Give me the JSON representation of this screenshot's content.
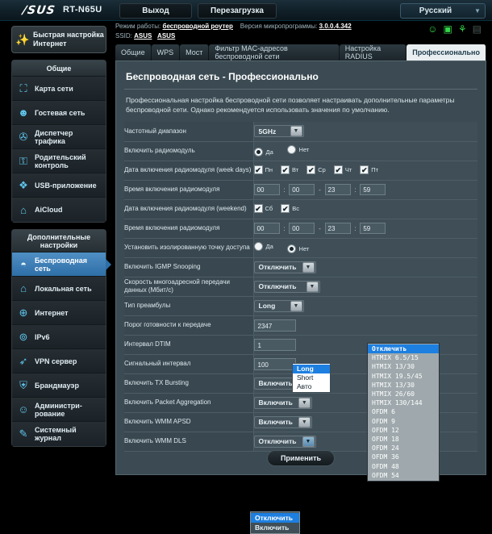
{
  "header": {
    "brand": "/SUS",
    "model": "RT-N65U",
    "logout_label": "Выход",
    "reboot_label": "Перезагрузка",
    "language": "Русский"
  },
  "info": {
    "mode_label": "Режим работы:",
    "mode_value": "беспроводной роутер",
    "firmware_label": "Версия микропрограммы:",
    "firmware_value": "3.0.0.4.342",
    "ssid_label": "SSID:",
    "ssid_1": "ASUS",
    "ssid_2": "ASUS",
    "status_icons": [
      "user-icon",
      "monitor-icon",
      "usb-icon",
      "printer-icon"
    ]
  },
  "quick_setup": {
    "line1": "Быстрая настройка",
    "line2": "Интернет"
  },
  "sidebar": {
    "general_header": "Общие",
    "general_items": [
      {
        "label": "Карта сети",
        "icon": "network-map-icon"
      },
      {
        "label": "Гостевая сеть",
        "icon": "guest-network-icon"
      },
      {
        "label": "Диспетчер трафика",
        "icon": "traffic-manager-icon"
      },
      {
        "label": "Родительский контроль",
        "icon": "parental-control-icon"
      },
      {
        "label": "USB-приложение",
        "icon": "usb-application-icon"
      },
      {
        "label": "AiCloud",
        "icon": "aicloud-icon"
      }
    ],
    "advanced_header": "Дополнительные настройки",
    "advanced_items": [
      {
        "label": "Беспроводная сеть",
        "icon": "wireless-icon",
        "active": true
      },
      {
        "label": "Локальная сеть",
        "icon": "lan-icon",
        "active": false
      },
      {
        "label": "Интернет",
        "icon": "wan-icon",
        "active": false
      },
      {
        "label": "IPv6",
        "icon": "ipv6-icon",
        "active": false
      },
      {
        "label": "VPN сервер",
        "icon": "vpn-icon",
        "active": false
      },
      {
        "label": "Брандмауэр",
        "icon": "firewall-icon",
        "active": false
      },
      {
        "label": "Администри-рование",
        "icon": "administration-icon",
        "active": false
      },
      {
        "label": "Системный журнал",
        "icon": "system-log-icon",
        "active": false
      }
    ]
  },
  "tabs": [
    {
      "label": "Общие",
      "active": false
    },
    {
      "label": "WPS",
      "active": false
    },
    {
      "label": "Мост",
      "active": false
    },
    {
      "label": "Фильтр MAC-адресов беспроводной сети",
      "active": false
    },
    {
      "label": "Настройка RADIUS",
      "active": false
    },
    {
      "label": "Профессионально",
      "active": true
    }
  ],
  "page": {
    "title": "Беспроводная сеть - Профессионально",
    "description": "Профессиональная настройка беспроводной сети позволяет настраивать дополнительные параметры беспроводной сети. Однако рекомендуется использовать значения по умолчанию."
  },
  "form": {
    "band": {
      "label": "Частотный диапазон",
      "value": "5GHz"
    },
    "radio_enable": {
      "label": "Включить радиомодуль",
      "yes": "Да",
      "no": "Нет",
      "selected": "Да"
    },
    "week_days": {
      "label": "Дата включения радиомодуля (week days)",
      "days": [
        {
          "label": "Пн",
          "checked": true
        },
        {
          "label": "Вт",
          "checked": true
        },
        {
          "label": "Ср",
          "checked": true
        },
        {
          "label": "Чт",
          "checked": true
        },
        {
          "label": "Пт",
          "checked": true
        }
      ]
    },
    "time_weekday": {
      "label": "Время включения радиомодуля",
      "h1": "00",
      "m1": "00",
      "h2": "23",
      "m2": "59"
    },
    "weekend_days": {
      "label": "Дата включения радиомодуля (weekend)",
      "days": [
        {
          "label": "Сб",
          "checked": true
        },
        {
          "label": "Вс",
          "checked": true
        }
      ]
    },
    "time_weekend": {
      "label": "Время включения радиомодуля",
      "h1": "00",
      "m1": "00",
      "h2": "23",
      "m2": "59"
    },
    "ap_isolated": {
      "label": "Установить изолированную точку доступа",
      "yes": "Да",
      "no": "Нет",
      "selected": "Нет"
    },
    "igmp": {
      "label": "Включить IGMP Snooping",
      "value": "Отключить"
    },
    "mcast_rate": {
      "label": "Скорость многоадресной передачи данных (Мбит/с)",
      "value": "Отключить",
      "open": true,
      "options": [
        "Отключить",
        "HTMIX 6.5/15",
        "HTMIX 13/30",
        "HTMIX 19.5/45",
        "HTMIX 13/30",
        "HTMIX 26/60",
        "HTMIX 130/144",
        "OFDM 6",
        "OFDM 9",
        "OFDM 12",
        "OFDM 18",
        "OFDM 24",
        "OFDM 36",
        "OFDM 48",
        "OFDM 54"
      ],
      "selected_index": 0
    },
    "preamble": {
      "label": "Тип преамбулы",
      "value": "Long",
      "open": true,
      "options": [
        "Long",
        "Short",
        "Авто"
      ],
      "selected_index": 0
    },
    "rts": {
      "label": "Порог готовности к передаче",
      "value": "2347"
    },
    "dtim": {
      "label": "Интервал DTIM",
      "value": "1"
    },
    "beacon": {
      "label": "Сигнальный интервал",
      "value": "100"
    },
    "tx_bursting": {
      "label": "Включить TX Bursting",
      "value": "Включить"
    },
    "packet_agg": {
      "label": "Включить Packet Aggregation",
      "value": "Включить"
    },
    "wmm_apsd": {
      "label": "Включить WMM APSD",
      "value": "Включить"
    },
    "wmm_dls": {
      "label": "Включить WMM DLS",
      "value": "Отключить",
      "open": true,
      "options": [
        "Отключить",
        "Включить"
      ],
      "selected_index": 0
    }
  },
  "apply_label": "Применить"
}
